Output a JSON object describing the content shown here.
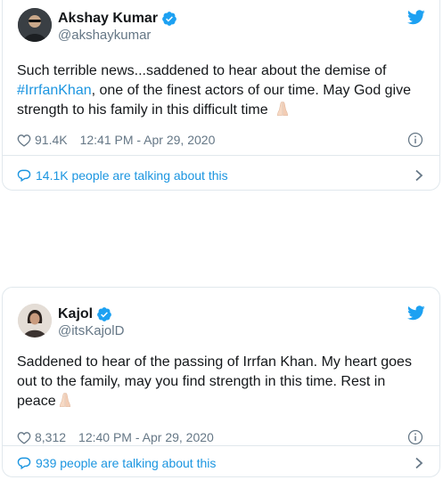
{
  "colors": {
    "accent": "#1b95e0",
    "text": "#14171a",
    "muted": "#657786",
    "border": "#e1e8ed",
    "verified": "#1da1f2"
  },
  "tweets": [
    {
      "author_name": "Akshay Kumar",
      "author_handle": "@akshaykumar",
      "verified": true,
      "text_before": "Such terrible news...saddened to hear about the demise of ",
      "hashtag": "#IrrfanKhan",
      "text_after": ", one of the finest actors of our time. May God give strength to his family in this difficult time",
      "likes": "91.4K",
      "timestamp": "12:41 PM - Apr 29, 2020",
      "talking": "14.1K people are talking about this"
    },
    {
      "author_name": "Kajol",
      "author_handle": "@itsKajolD",
      "verified": true,
      "text_before": "Saddened to hear of the passing of Irrfan Khan. My heart goes out to the family, may you find strength in this time. Rest in peace",
      "hashtag": "",
      "text_after": "",
      "likes": "8,312",
      "timestamp": "12:40 PM - Apr 29, 2020",
      "talking": "939 people are talking about this"
    }
  ],
  "icons": {
    "brand": "twitter-bird-icon",
    "verified": "verified-badge-icon",
    "like": "heart-icon",
    "info": "info-icon",
    "reply": "speech-bubble-icon",
    "more": "chevron-right-icon",
    "emoji": "folded-hands-emoji-icon"
  }
}
